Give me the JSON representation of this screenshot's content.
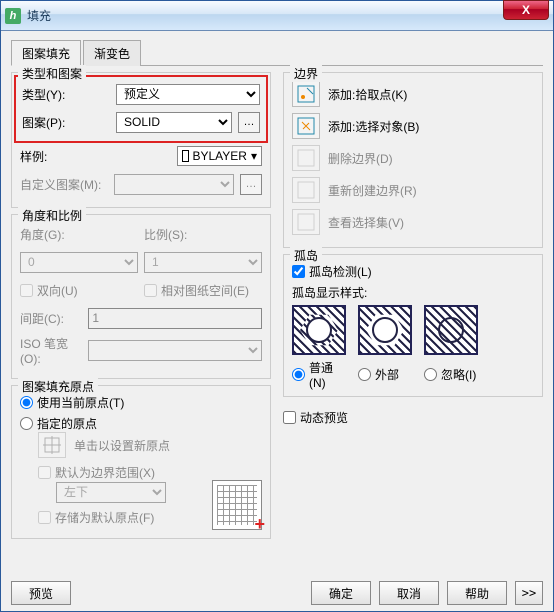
{
  "window": {
    "title": "填充"
  },
  "tabs": {
    "t1": "图案填充",
    "t2": "渐变色"
  },
  "typeGroup": {
    "legend": "类型和图案",
    "typeLabel": "类型(Y):",
    "typeValue": "预定义",
    "patternLabel": "图案(P):",
    "patternValue": "SOLID",
    "swatchLabel": "样例:",
    "swatchText": "BYLAYER",
    "customLabel": "自定义图案(M):"
  },
  "angleGroup": {
    "legend": "角度和比例",
    "angleLabel": "角度(G):",
    "angleValue": "0",
    "scaleLabel": "比例(S):",
    "scaleValue": "1",
    "bidir": "双向(U)",
    "paperspace": "相对图纸空间(E)",
    "spacingLabel": "间距(C):",
    "spacingValue": "1",
    "isoLabel": "ISO 笔宽(O):"
  },
  "originGroup": {
    "legend": "图案填充原点",
    "useCurrent": "使用当前原点(T)",
    "specified": "指定的原点",
    "clickSet": "单击以设置新原点",
    "defaultBoundary": "默认为边界范围(X)",
    "position": "左下",
    "storeDefault": "存储为默认原点(F)"
  },
  "boundary": {
    "legend": "边界",
    "addPick": "添加:拾取点(K)",
    "addSelect": "添加:选择对象(B)",
    "removeBoundary": "删除边界(D)",
    "recreate": "重新创建边界(R)",
    "viewSelection": "查看选择集(V)"
  },
  "island": {
    "legend": "孤岛",
    "detect": "孤岛检测(L)",
    "styleLabel": "孤岛显示样式:",
    "r1": "普通(N)",
    "r2": "外部",
    "r3": "忽略(I)"
  },
  "dynamic": "动态预览",
  "footer": {
    "preview": "预览",
    "ok": "确定",
    "cancel": "取消",
    "help": "帮助"
  }
}
